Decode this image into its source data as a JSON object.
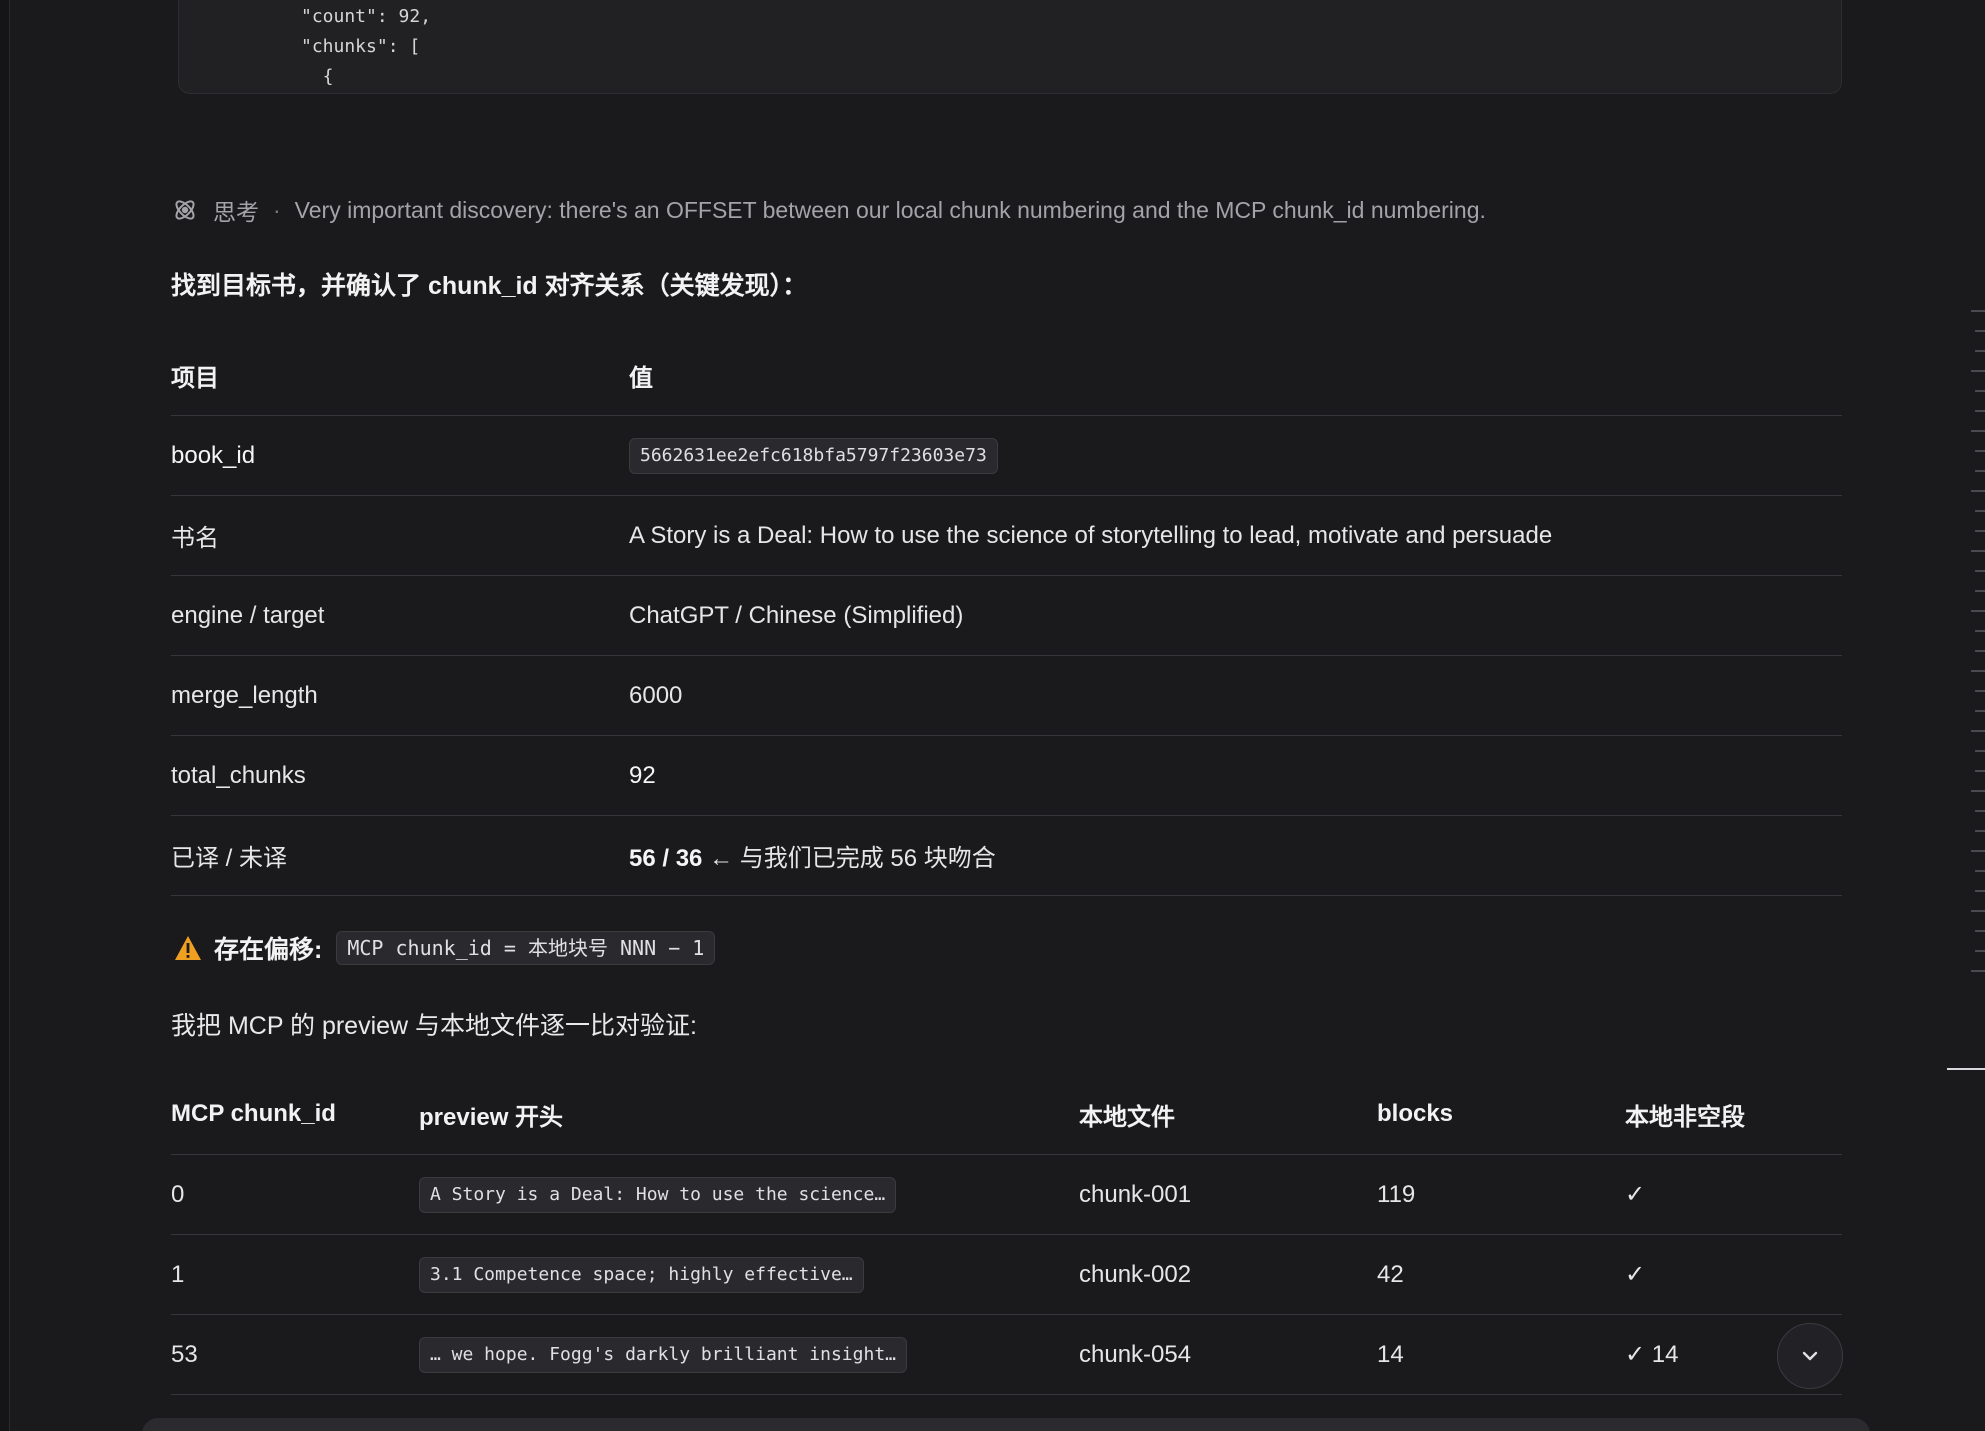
{
  "code_block": {
    "lines": [
      "\"count\": 92,",
      "\"chunks\": [",
      "  {"
    ]
  },
  "thought": {
    "label": "思考",
    "separator": "·",
    "text": "Very important discovery: there's an OFFSET between our local chunk numbering and the MCP chunk_id numbering."
  },
  "heading": "找到目标书，并确认了 chunk_id 对齐关系（关键发现）：",
  "info_table": {
    "headers": [
      "项目",
      "值"
    ],
    "rows": [
      {
        "key": "book_id",
        "value": "5662631ee2efc618bfa5797f23603e73"
      },
      {
        "key": "书名",
        "value": "A Story is a Deal: How to use the science of storytelling to lead, motivate and persuade"
      },
      {
        "key": "engine / target",
        "value": "ChatGPT / Chinese (Simplified)"
      },
      {
        "key": "merge_length",
        "value": "6000"
      },
      {
        "key": "total_chunks",
        "value": "92"
      },
      {
        "key": "已译 / 未译",
        "value_bold": "56 / 36",
        "value_rest": " ← 与我们已完成 56 块吻合"
      }
    ]
  },
  "warning": {
    "label": "存在偏移:",
    "code": "MCP chunk_id = 本地块号 NNN − 1"
  },
  "verify_text": "我把 MCP 的 preview 与本地文件逐一比对验证:",
  "chunk_table": {
    "headers": [
      "MCP chunk_id",
      "preview 开头",
      "本地文件",
      "blocks",
      "本地非空段"
    ],
    "rows": [
      {
        "id": "0",
        "preview": "A Story is a Deal: How to use the science…",
        "file": "chunk-001",
        "blocks": "119",
        "nonempty": "✓"
      },
      {
        "id": "1",
        "preview": "3.1 Competence space; highly effective…",
        "file": "chunk-002",
        "blocks": "42",
        "nonempty": "✓"
      },
      {
        "id": "53",
        "preview": "… we hope. Fogg's darkly brilliant insight…",
        "file": "chunk-054",
        "blocks": "14",
        "nonempty": "✓ 14"
      }
    ]
  },
  "icons": {
    "thought": "brain-icon",
    "warning": "warning-triangle-icon",
    "scroll": "chevron-down-icon"
  },
  "colors": {
    "background": "#1a1a1c",
    "warning": "#f0a020"
  }
}
